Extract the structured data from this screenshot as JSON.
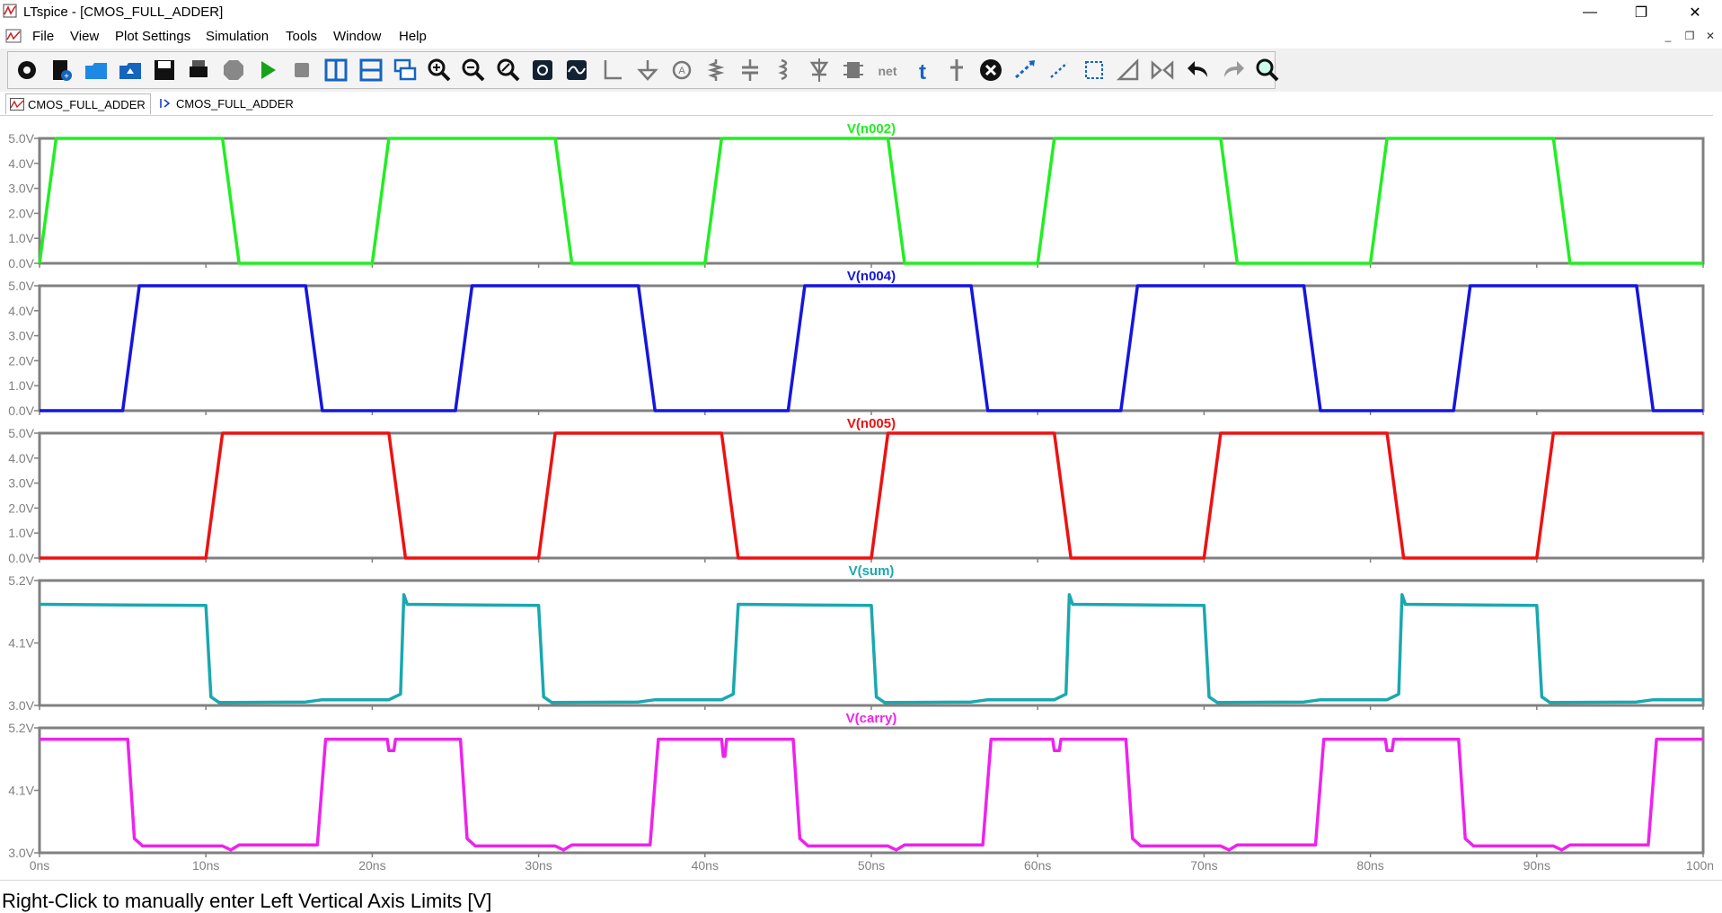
{
  "window": {
    "title": "LTspice - [CMOS_FULL_ADDER]",
    "controls": {
      "minimize": "—",
      "restore": "❐",
      "close": "✕"
    }
  },
  "menu": {
    "items": [
      "File",
      "View",
      "Plot Settings",
      "Simulation",
      "Tools",
      "Window",
      "Help"
    ],
    "mdi": {
      "minimize": "_",
      "restore": "❐",
      "close": "✕"
    }
  },
  "toolbar": {
    "icons": [
      "gear-icon",
      "new-schematic-icon",
      "open-icon",
      "open-examples-icon",
      "save-icon",
      "print-icon",
      "halt-icon",
      "run-icon",
      "stop-icon",
      "tile-vertical-icon",
      "tile-horizontal-icon",
      "cascade-icon",
      "zoom-in-icon",
      "zoom-out-icon",
      "zoom-fit-icon",
      "autorange-icon",
      "waveform-icon",
      "wire-icon",
      "ground-icon",
      "label-icon",
      "resistor-icon",
      "capacitor-icon",
      "inductor-icon",
      "diode-icon",
      "component-icon",
      "net-icon",
      "text-icon",
      "move-icon",
      "delete-icon",
      "duplicate-icon",
      "move-drag-icon",
      "drag-icon",
      "rotate-icon",
      "mirror-icon",
      "undo-icon",
      "redo-icon",
      "find-icon"
    ]
  },
  "tabs": [
    {
      "label": "CMOS_FULL_ADDER",
      "icon": "waveform-icon"
    },
    {
      "label": "CMOS_FULL_ADDER",
      "icon": "schematic-icon"
    }
  ],
  "status": {
    "text": "Right-Click to manually enter Left Vertical Axis Limits [V]"
  },
  "chart_data": {
    "type": "line",
    "x_unit": "ns",
    "xlim": [
      0,
      100
    ],
    "x_ticks": [
      "0ns",
      "10ns",
      "20ns",
      "30ns",
      "40ns",
      "50ns",
      "60ns",
      "70ns",
      "80ns",
      "90ns",
      "100ns"
    ],
    "panes": [
      {
        "name": "V(n002)",
        "color": "#22ee22",
        "y_ticks": [
          "5.0V",
          "4.0V",
          "3.0V",
          "2.0V",
          "1.0V",
          "0.0V"
        ],
        "ylim": [
          0,
          5
        ],
        "x": [
          0,
          1,
          11,
          12,
          20,
          21,
          31,
          32,
          40,
          41,
          51,
          52,
          60,
          61,
          71,
          72,
          80,
          81,
          91,
          92,
          100
        ],
        "y": [
          0,
          5,
          5,
          0,
          0,
          5,
          5,
          0,
          0,
          5,
          5,
          0,
          0,
          5,
          5,
          0,
          0,
          5,
          5,
          0,
          0
        ]
      },
      {
        "name": "V(n004)",
        "color": "#1515e0",
        "y_ticks": [
          "5.0V",
          "4.0V",
          "3.0V",
          "2.0V",
          "1.0V",
          "0.0V"
        ],
        "ylim": [
          0,
          5
        ],
        "x": [
          0,
          5,
          6,
          16,
          17,
          25,
          26,
          36,
          37,
          45,
          46,
          56,
          57,
          65,
          66,
          76,
          77,
          85,
          86,
          96,
          97,
          100
        ],
        "y": [
          0,
          0,
          5,
          5,
          0,
          0,
          5,
          5,
          0,
          0,
          5,
          5,
          0,
          0,
          5,
          5,
          0,
          0,
          5,
          5,
          0,
          0
        ]
      },
      {
        "name": "V(n005)",
        "color": "#ee1111",
        "y_ticks": [
          "5.0V",
          "4.0V",
          "3.0V",
          "2.0V",
          "1.0V",
          "0.0V"
        ],
        "ylim": [
          0,
          5
        ],
        "x": [
          0,
          10,
          11,
          21,
          22,
          30,
          31,
          41,
          42,
          50,
          51,
          61,
          62,
          70,
          71,
          81,
          82,
          90,
          91,
          100
        ],
        "y": [
          0,
          0,
          5,
          5,
          0,
          0,
          5,
          5,
          0,
          0,
          5,
          5,
          0,
          0,
          5,
          5,
          0,
          0,
          5,
          5
        ]
      },
      {
        "name": "V(sum)",
        "color": "#1aa8b0",
        "y_ticks": [
          "5.2V",
          "4.1V",
          "3.0V"
        ],
        "ylim": [
          3.0,
          5.2
        ],
        "x": [
          0,
          10,
          10.3,
          10.8,
          16,
          17,
          21,
          21.7,
          21.9,
          22.1,
          30,
          30.3,
          30.8,
          36,
          37,
          41,
          41.7,
          42,
          50,
          50.3,
          50.8,
          56,
          57,
          61,
          61.7,
          61.9,
          62.1,
          70,
          70.3,
          70.8,
          76,
          77,
          81,
          81.7,
          81.9,
          82.1,
          90,
          90.3,
          90.8,
          96,
          97,
          100
        ],
        "y": [
          4.78,
          4.76,
          3.15,
          3.05,
          3.06,
          3.1,
          3.1,
          3.2,
          4.95,
          4.78,
          4.76,
          3.15,
          3.05,
          3.06,
          3.1,
          3.1,
          3.2,
          4.78,
          4.76,
          3.15,
          3.05,
          3.06,
          3.1,
          3.1,
          3.2,
          4.95,
          4.78,
          4.76,
          3.15,
          3.05,
          3.06,
          3.1,
          3.1,
          3.2,
          4.95,
          4.78,
          4.76,
          3.15,
          3.05,
          3.06,
          3.1,
          3.1
        ]
      },
      {
        "name": "V(carry)",
        "color": "#ee22ee",
        "y_ticks": [
          "5.2V",
          "4.1V",
          "3.0V"
        ],
        "ylim": [
          3.0,
          5.2
        ],
        "x": [
          0,
          5.3,
          5.7,
          6.2,
          11,
          11.5,
          12,
          16.7,
          17.2,
          20.9,
          21,
          21.3,
          21.4,
          25.3,
          25.7,
          26.2,
          31,
          31.5,
          32,
          36.7,
          37.2,
          41.0,
          41.1,
          41.2,
          41.3,
          45.3,
          45.7,
          46.2,
          51,
          51.5,
          52,
          56.7,
          57.2,
          60.9,
          61,
          61.3,
          61.4,
          65.3,
          65.7,
          66.2,
          71,
          71.5,
          72,
          76.7,
          77.2,
          80.9,
          81,
          81.3,
          81.4,
          85.3,
          85.7,
          86.2,
          91,
          91.5,
          92,
          96.7,
          97.2,
          100
        ],
        "y": [
          5.0,
          5.0,
          3.25,
          3.12,
          3.12,
          3.05,
          3.14,
          3.14,
          5.0,
          5.0,
          4.8,
          4.8,
          5.0,
          5.0,
          3.25,
          3.12,
          3.12,
          3.05,
          3.14,
          3.14,
          5.0,
          5.0,
          4.7,
          4.7,
          5.0,
          5.0,
          3.25,
          3.12,
          3.12,
          3.05,
          3.14,
          3.14,
          5.0,
          5.0,
          4.8,
          4.8,
          5.0,
          5.0,
          3.25,
          3.12,
          3.12,
          3.05,
          3.14,
          3.14,
          5.0,
          5.0,
          4.8,
          4.8,
          5.0,
          5.0,
          3.25,
          3.12,
          3.12,
          3.05,
          3.14,
          3.14,
          5.0,
          5.0
        ]
      }
    ]
  }
}
